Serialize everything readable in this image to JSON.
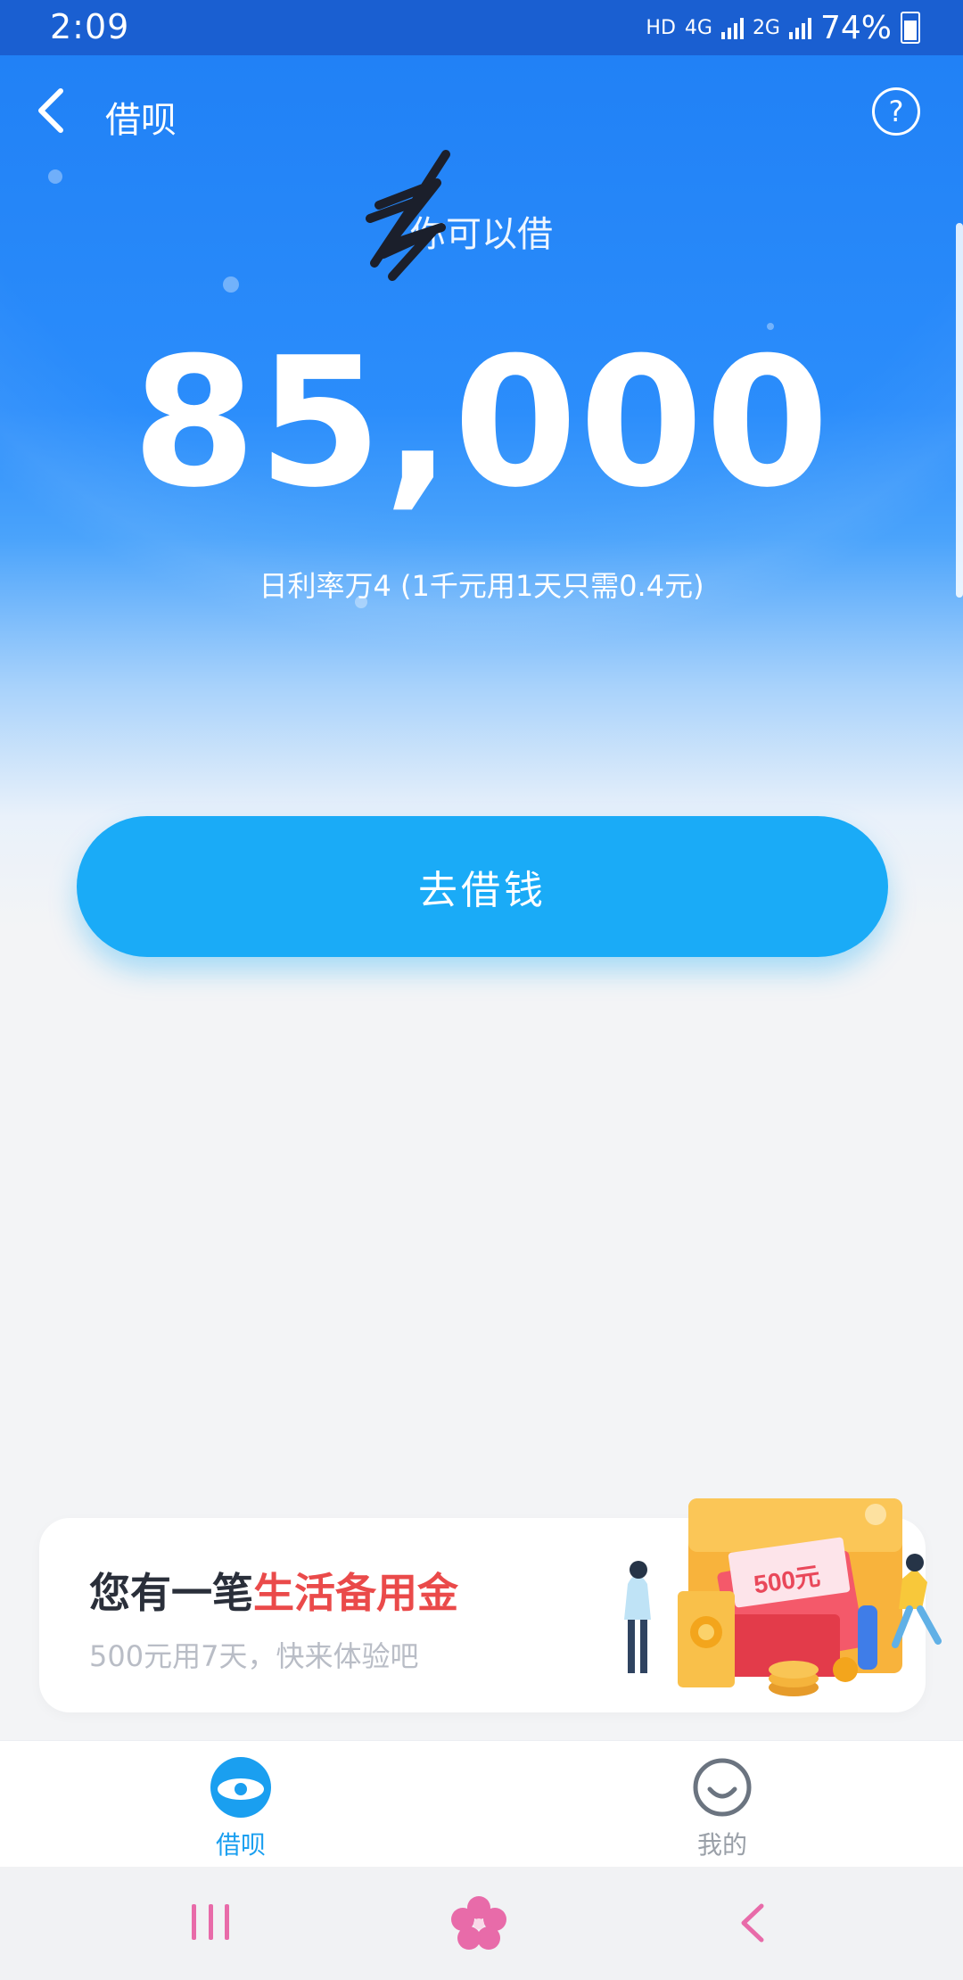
{
  "status_bar": {
    "time": "2:09",
    "hd_label": "HD",
    "network_4g": "4G",
    "network_2g": "2G",
    "battery_percent": "74%"
  },
  "header": {
    "back_icon": "chevron-left-icon",
    "title": "借呗",
    "help_icon": "question-circle-icon"
  },
  "hero": {
    "subtitle": "你可以借",
    "amount": "85,000",
    "rate_text": "日利率万4 (1千元用1天只需0.4元)"
  },
  "actions": {
    "borrow_button": "去借钱"
  },
  "promo": {
    "title_prefix": "您有一笔",
    "title_highlight": "生活备用金",
    "subtitle": "500元用7天，快来体验吧",
    "badge_text": "500元"
  },
  "tabbar": {
    "items": [
      {
        "label": "借呗",
        "icon": "borrow-icon",
        "active": true
      },
      {
        "label": "我的",
        "icon": "smiley-icon",
        "active": false
      }
    ]
  },
  "colors": {
    "primary": "#1aabf7",
    "header_blue": "#2b8dfb",
    "highlight_red": "#ea4a4a",
    "nav_pink": "#e86ba9"
  }
}
